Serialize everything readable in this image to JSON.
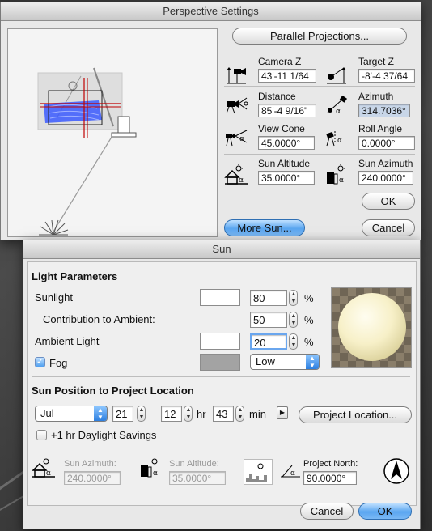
{
  "perspective": {
    "title": "Perspective Settings",
    "parallel_button": "Parallel Projections...",
    "camera_z": {
      "label": "Camera Z",
      "value": "43'-11 1/64"
    },
    "target_z": {
      "label": "Target Z",
      "value": "-8'-4 37/64"
    },
    "distance": {
      "label": "Distance",
      "value": "85'-4 9/16\""
    },
    "azimuth": {
      "label": "Azimuth",
      "value": "314.7036°"
    },
    "view_cone": {
      "label": "View Cone",
      "value": "45.0000°"
    },
    "roll_angle": {
      "label": "Roll Angle",
      "value": "0.0000°"
    },
    "sun_altitude": {
      "label": "Sun Altitude",
      "value": "35.0000°"
    },
    "sun_azimuth": {
      "label": "Sun Azimuth",
      "value": "240.0000°"
    },
    "ok_button": "OK",
    "more_sun_button": "More Sun...",
    "cancel_button": "Cancel",
    "preview_icon": "floor-plan-preview"
  },
  "sun": {
    "title": "Sun",
    "light_parameters": {
      "header": "Light Parameters",
      "sunlight": {
        "label": "Sunlight",
        "value": "80",
        "unit": "%"
      },
      "contribution": {
        "label": "Contribution to Ambient:",
        "value": "50",
        "unit": "%"
      },
      "ambient": {
        "label": "Ambient Light",
        "value": "20",
        "unit": "%"
      },
      "fog": {
        "label": "Fog",
        "checked": true,
        "level": "Low"
      }
    },
    "sun_position": {
      "header": "Sun Position to Project Location",
      "month": "Jul",
      "day": "21",
      "hour": "12",
      "hour_unit": "hr",
      "minute": "43",
      "minute_unit": "min",
      "project_location_button": "Project Location...",
      "daylight_savings": "+1 hr Daylight Savings"
    },
    "readouts": {
      "azimuth_label": "Sun Azimuth:",
      "azimuth_value": "240.0000°",
      "altitude_label": "Sun Altitude:",
      "altitude_value": "35.0000°",
      "north_label": "Project North:",
      "north_value": "90.0000°"
    },
    "cancel_button": "Cancel",
    "ok_button": "OK"
  },
  "colors": {
    "accent": "#5aa6f0",
    "preview_blue": "#3b5bff",
    "preview_red": "#c00000"
  }
}
